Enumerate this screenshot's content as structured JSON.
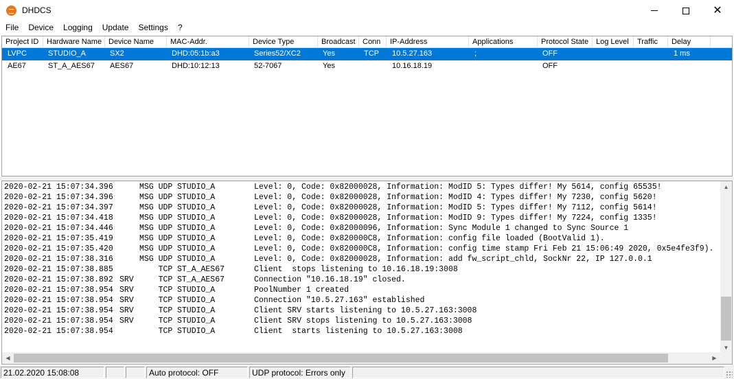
{
  "window": {
    "title": "DHDCS",
    "icon": "dhd-logo-icon",
    "accent_color": "#e87722"
  },
  "menu": [
    "File",
    "Device",
    "Logging",
    "Update",
    "Settings",
    "?"
  ],
  "device_table": {
    "columns": [
      "Project ID",
      "Hardware Name",
      "Device Name",
      "MAC-Addr.",
      "Device Type",
      "Broadcast",
      "Conn",
      "IP-Address",
      "Applications",
      "Protocol State",
      "Log Level",
      "Traffic",
      "Delay"
    ],
    "selection_color": "#0078d7",
    "rows": [
      {
        "project_id": "LVPC",
        "hardware_name": "STUDIO_A",
        "device_name": "SX2",
        "mac": "DHD:05:1b:a3",
        "device_type": "Series52/XC2",
        "broadcast": "Yes",
        "conn": "TCP",
        "ip": "10.5.27.163",
        "applications": ";",
        "protocol_state": "OFF",
        "log_level": "",
        "traffic": "",
        "delay": "1 ms",
        "selected": true
      },
      {
        "project_id": "AE67",
        "hardware_name": "ST_A_AES67",
        "device_name": "AES67",
        "mac": "DHD:10:12:13",
        "device_type": "52-7067",
        "broadcast": "Yes",
        "conn": "",
        "ip": "10.16.18.19",
        "applications": "",
        "protocol_state": "OFF",
        "log_level": "",
        "traffic": "",
        "delay": "",
        "selected": false
      }
    ]
  },
  "log": [
    {
      "ts": "2020-02-21 15:07:34.396",
      "src": "",
      "proto": "MSG UDP",
      "dev": "STUDIO_A",
      "msg": "Level: 0, Code: 0x82000028, Information: ModID 5: Types differ! My 5614, config 65535!"
    },
    {
      "ts": "2020-02-21 15:07:34.396",
      "src": "",
      "proto": "MSG UDP",
      "dev": "STUDIO_A",
      "msg": "Level: 0, Code: 0x82000028, Information: ModID 4: Types differ! My 7230, config 5620!"
    },
    {
      "ts": "2020-02-21 15:07:34.397",
      "src": "",
      "proto": "MSG UDP",
      "dev": "STUDIO_A",
      "msg": "Level: 0, Code: 0x82000028, Information: ModID 5: Types differ! My 7112, config 5614!"
    },
    {
      "ts": "2020-02-21 15:07:34.418",
      "src": "",
      "proto": "MSG UDP",
      "dev": "STUDIO_A",
      "msg": "Level: 0, Code: 0x82000028, Information: ModID 9: Types differ! My 7224, config 1335!"
    },
    {
      "ts": "2020-02-21 15:07:34.446",
      "src": "",
      "proto": "MSG UDP",
      "dev": "STUDIO_A",
      "msg": "Level: 0, Code: 0x82000096, Information: Sync Module 1 changed to Sync Source 1"
    },
    {
      "ts": "2020-02-21 15:07:35.419",
      "src": "",
      "proto": "MSG UDP",
      "dev": "STUDIO_A",
      "msg": "Level: 0, Code: 0x820000C8, Information: config file loaded (BootValid 1)."
    },
    {
      "ts": "2020-02-21 15:07:35.420",
      "src": "",
      "proto": "MSG UDP",
      "dev": "STUDIO_A",
      "msg": "Level: 0, Code: 0x820000C8, Information: config time stamp Fri Feb 21 15:06:49 2020, 0x5e4fe3f9)."
    },
    {
      "ts": "2020-02-21 15:07:38.316",
      "src": "",
      "proto": "MSG UDP",
      "dev": "STUDIO_A",
      "msg": "Level: 0, Code: 0x82000028, Information: add fw_script_chld, SockNr 22, IP 127.0.0.1"
    },
    {
      "ts": "2020-02-21 15:07:38.885",
      "src": "",
      "proto": "    TCP",
      "dev": "ST_A_AES67",
      "msg": "Client  stops listening to 10.16.18.19:3008"
    },
    {
      "ts": "2020-02-21 15:07:38.892",
      "src": "SRV",
      "proto": "    TCP",
      "dev": "ST_A_AES67",
      "msg": "Connection \"10.16.18.19\" closed."
    },
    {
      "ts": "2020-02-21 15:07:38.954",
      "src": "SRV",
      "proto": "    TCP",
      "dev": "STUDIO_A",
      "msg": "PoolNumber 1 created"
    },
    {
      "ts": "2020-02-21 15:07:38.954",
      "src": "SRV",
      "proto": "    TCP",
      "dev": "STUDIO_A",
      "msg": "Connection \"10.5.27.163\" established"
    },
    {
      "ts": "2020-02-21 15:07:38.954",
      "src": "SRV",
      "proto": "    TCP",
      "dev": "STUDIO_A",
      "msg": "Client SRV starts listening to 10.5.27.163:3008"
    },
    {
      "ts": "2020-02-21 15:07:38.954",
      "src": "SRV",
      "proto": "    TCP",
      "dev": "STUDIO_A",
      "msg": "Client SRV stops listening to 10.5.27.163:3008"
    },
    {
      "ts": "2020-02-21 15:07:38.954",
      "src": "",
      "proto": "    TCP",
      "dev": "STUDIO_A",
      "msg": "Client  starts listening to 10.5.27.163:3008"
    }
  ],
  "status": {
    "datetime": "21.02.2020 15:08:08",
    "empty1": "",
    "empty2": "",
    "auto_protocol": "Auto protocol: OFF",
    "udp_protocol": "UDP protocol: Errors only",
    "empty3": ""
  }
}
